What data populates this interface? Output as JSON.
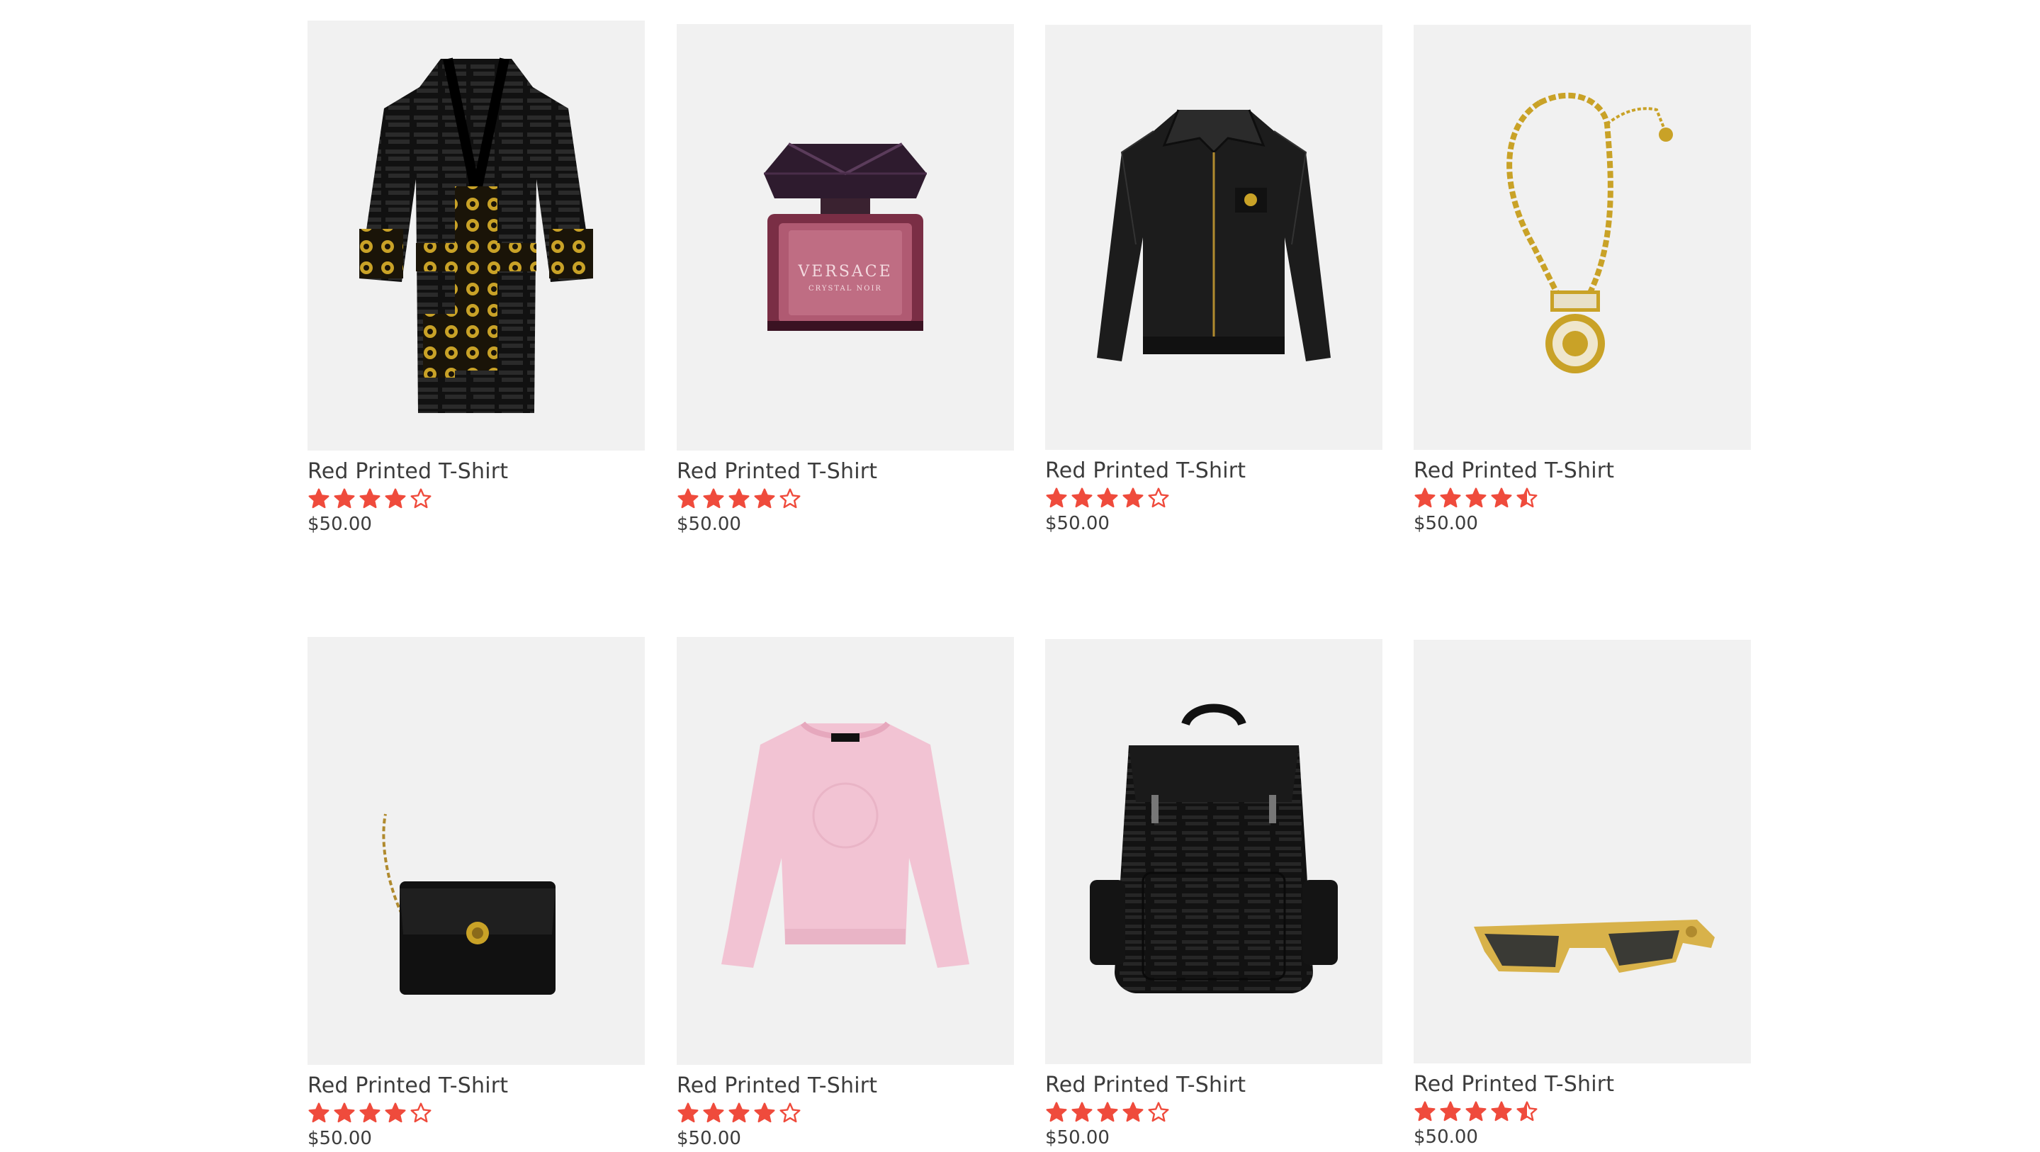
{
  "accent_color": "#ef4b3c",
  "products": [
    {
      "name": "Red Printed T-Shirt",
      "price": "$50.00",
      "rating": 4,
      "image": "bathrobe-image"
    },
    {
      "name": "Red Printed T-Shirt",
      "price": "$50.00",
      "rating": 4,
      "image": "perfume-image"
    },
    {
      "name": "Red Printed T-Shirt",
      "price": "$50.00",
      "rating": 4,
      "image": "leather-jacket-image"
    },
    {
      "name": "Red Printed T-Shirt",
      "price": "$50.00",
      "rating": 4.5,
      "image": "necklace-image"
    },
    {
      "name": "Red Printed T-Shirt",
      "price": "$50.00",
      "rating": 4,
      "image": "handbag-image"
    },
    {
      "name": "Red Printed T-Shirt",
      "price": "$50.00",
      "rating": 4,
      "image": "sweater-image"
    },
    {
      "name": "Red Printed T-Shirt",
      "price": "$50.00",
      "rating": 4,
      "image": "backpack-image"
    },
    {
      "name": "Red Printed T-Shirt",
      "price": "$50.00",
      "rating": 4.5,
      "image": "sunglasses-image"
    }
  ]
}
